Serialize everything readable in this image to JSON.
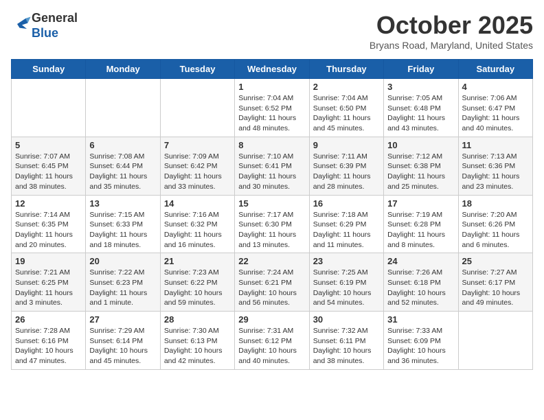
{
  "header": {
    "logo_line1": "General",
    "logo_line2": "Blue",
    "month_title": "October 2025",
    "location": "Bryans Road, Maryland, United States"
  },
  "weekdays": [
    "Sunday",
    "Monday",
    "Tuesday",
    "Wednesday",
    "Thursday",
    "Friday",
    "Saturday"
  ],
  "weeks": [
    [
      {
        "day": "",
        "info": ""
      },
      {
        "day": "",
        "info": ""
      },
      {
        "day": "",
        "info": ""
      },
      {
        "day": "1",
        "info": "Sunrise: 7:04 AM\nSunset: 6:52 PM\nDaylight: 11 hours\nand 48 minutes."
      },
      {
        "day": "2",
        "info": "Sunrise: 7:04 AM\nSunset: 6:50 PM\nDaylight: 11 hours\nand 45 minutes."
      },
      {
        "day": "3",
        "info": "Sunrise: 7:05 AM\nSunset: 6:48 PM\nDaylight: 11 hours\nand 43 minutes."
      },
      {
        "day": "4",
        "info": "Sunrise: 7:06 AM\nSunset: 6:47 PM\nDaylight: 11 hours\nand 40 minutes."
      }
    ],
    [
      {
        "day": "5",
        "info": "Sunrise: 7:07 AM\nSunset: 6:45 PM\nDaylight: 11 hours\nand 38 minutes."
      },
      {
        "day": "6",
        "info": "Sunrise: 7:08 AM\nSunset: 6:44 PM\nDaylight: 11 hours\nand 35 minutes."
      },
      {
        "day": "7",
        "info": "Sunrise: 7:09 AM\nSunset: 6:42 PM\nDaylight: 11 hours\nand 33 minutes."
      },
      {
        "day": "8",
        "info": "Sunrise: 7:10 AM\nSunset: 6:41 PM\nDaylight: 11 hours\nand 30 minutes."
      },
      {
        "day": "9",
        "info": "Sunrise: 7:11 AM\nSunset: 6:39 PM\nDaylight: 11 hours\nand 28 minutes."
      },
      {
        "day": "10",
        "info": "Sunrise: 7:12 AM\nSunset: 6:38 PM\nDaylight: 11 hours\nand 25 minutes."
      },
      {
        "day": "11",
        "info": "Sunrise: 7:13 AM\nSunset: 6:36 PM\nDaylight: 11 hours\nand 23 minutes."
      }
    ],
    [
      {
        "day": "12",
        "info": "Sunrise: 7:14 AM\nSunset: 6:35 PM\nDaylight: 11 hours\nand 20 minutes."
      },
      {
        "day": "13",
        "info": "Sunrise: 7:15 AM\nSunset: 6:33 PM\nDaylight: 11 hours\nand 18 minutes."
      },
      {
        "day": "14",
        "info": "Sunrise: 7:16 AM\nSunset: 6:32 PM\nDaylight: 11 hours\nand 16 minutes."
      },
      {
        "day": "15",
        "info": "Sunrise: 7:17 AM\nSunset: 6:30 PM\nDaylight: 11 hours\nand 13 minutes."
      },
      {
        "day": "16",
        "info": "Sunrise: 7:18 AM\nSunset: 6:29 PM\nDaylight: 11 hours\nand 11 minutes."
      },
      {
        "day": "17",
        "info": "Sunrise: 7:19 AM\nSunset: 6:28 PM\nDaylight: 11 hours\nand 8 minutes."
      },
      {
        "day": "18",
        "info": "Sunrise: 7:20 AM\nSunset: 6:26 PM\nDaylight: 11 hours\nand 6 minutes."
      }
    ],
    [
      {
        "day": "19",
        "info": "Sunrise: 7:21 AM\nSunset: 6:25 PM\nDaylight: 11 hours\nand 3 minutes."
      },
      {
        "day": "20",
        "info": "Sunrise: 7:22 AM\nSunset: 6:23 PM\nDaylight: 11 hours\nand 1 minute."
      },
      {
        "day": "21",
        "info": "Sunrise: 7:23 AM\nSunset: 6:22 PM\nDaylight: 10 hours\nand 59 minutes."
      },
      {
        "day": "22",
        "info": "Sunrise: 7:24 AM\nSunset: 6:21 PM\nDaylight: 10 hours\nand 56 minutes."
      },
      {
        "day": "23",
        "info": "Sunrise: 7:25 AM\nSunset: 6:19 PM\nDaylight: 10 hours\nand 54 minutes."
      },
      {
        "day": "24",
        "info": "Sunrise: 7:26 AM\nSunset: 6:18 PM\nDaylight: 10 hours\nand 52 minutes."
      },
      {
        "day": "25",
        "info": "Sunrise: 7:27 AM\nSunset: 6:17 PM\nDaylight: 10 hours\nand 49 minutes."
      }
    ],
    [
      {
        "day": "26",
        "info": "Sunrise: 7:28 AM\nSunset: 6:16 PM\nDaylight: 10 hours\nand 47 minutes."
      },
      {
        "day": "27",
        "info": "Sunrise: 7:29 AM\nSunset: 6:14 PM\nDaylight: 10 hours\nand 45 minutes."
      },
      {
        "day": "28",
        "info": "Sunrise: 7:30 AM\nSunset: 6:13 PM\nDaylight: 10 hours\nand 42 minutes."
      },
      {
        "day": "29",
        "info": "Sunrise: 7:31 AM\nSunset: 6:12 PM\nDaylight: 10 hours\nand 40 minutes."
      },
      {
        "day": "30",
        "info": "Sunrise: 7:32 AM\nSunset: 6:11 PM\nDaylight: 10 hours\nand 38 minutes."
      },
      {
        "day": "31",
        "info": "Sunrise: 7:33 AM\nSunset: 6:09 PM\nDaylight: 10 hours\nand 36 minutes."
      },
      {
        "day": "",
        "info": ""
      }
    ]
  ]
}
